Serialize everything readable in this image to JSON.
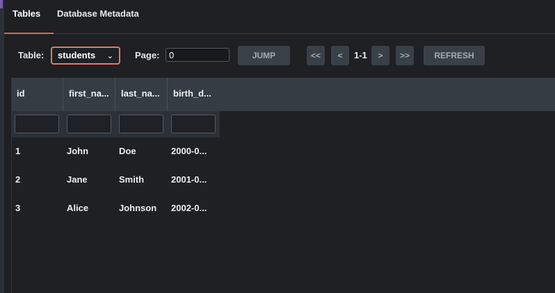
{
  "tabs": [
    {
      "label": "Tables",
      "active": true
    },
    {
      "label": "Database Metadata",
      "active": false
    }
  ],
  "toolbar": {
    "table_label": "Table:",
    "table_value": "students",
    "page_label": "Page:",
    "page_value": "0",
    "jump_label": "JUMP",
    "first_label": "<<",
    "prev_label": "<",
    "range_text": "1-1",
    "next_label": ">",
    "last_label": ">>",
    "refresh_label": "REFRESH"
  },
  "grid": {
    "columns": [
      "id",
      "first_na...",
      "last_na...",
      "birth_d..."
    ],
    "rows": [
      [
        "1",
        "John",
        "Doe",
        "2000-0..."
      ],
      [
        "2",
        "Jane",
        "Smith",
        "2001-0..."
      ],
      [
        "3",
        "Alice",
        "Johnson",
        "2002-0..."
      ]
    ]
  },
  "colors": {
    "background": "#1e2023",
    "accent": "#e0664b",
    "header": "#363c44",
    "button": "#3a4048"
  }
}
